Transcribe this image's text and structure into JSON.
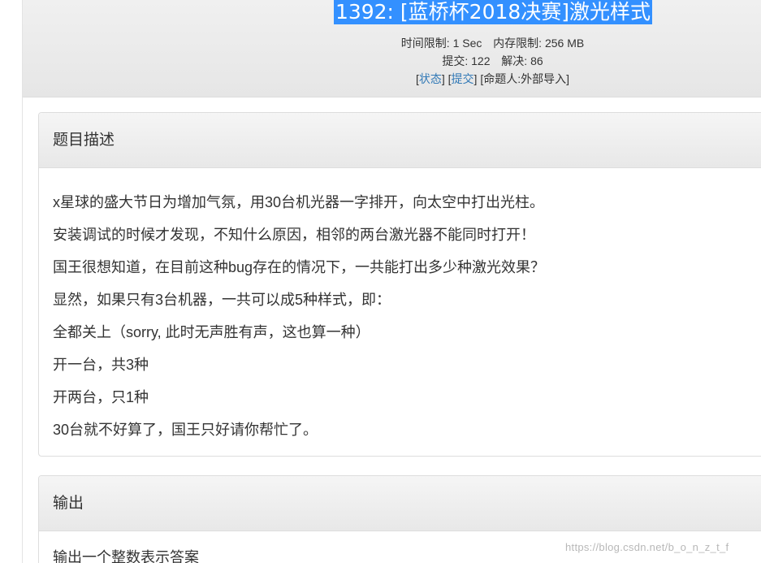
{
  "problem": {
    "title": "1392: [蓝桥杯2018决赛]激光样式",
    "time_limit_label": "时间限制:",
    "time_limit_value": "1 Sec",
    "memory_limit_label": "内存限制:",
    "memory_limit_value": "256 MB",
    "submit_label": "提交:",
    "submit_count": "122",
    "solved_label": "解决:",
    "solved_count": "86",
    "status_link": "状态",
    "submit_link": "提交",
    "author": "[命题人:外部导入]"
  },
  "description": {
    "heading": "题目描述",
    "lines": [
      "x星球的盛大节日为增加气氛，用30台机光器一字排开，向太空中打出光柱。",
      "安装调试的时候才发现，不知什么原因，相邻的两台激光器不能同时打开！",
      "国王很想知道，在目前这种bug存在的情况下，一共能打出多少种激光效果？",
      "显然，如果只有3台机器，一共可以成5种样式，即：",
      "全都关上（sorry, 此时无声胜有声，这也算一种）",
      "开一台，共3种",
      "开两台，只1种",
      "30台就不好算了，国王只好请你帮忙了。"
    ]
  },
  "output": {
    "heading": "输出",
    "text": "输出一个整数表示答案"
  },
  "watermark": "https://blog.csdn.net/b_o_n_z_t_f",
  "colors": {
    "title_highlight": "#3390ff",
    "link": "#337ab7"
  }
}
